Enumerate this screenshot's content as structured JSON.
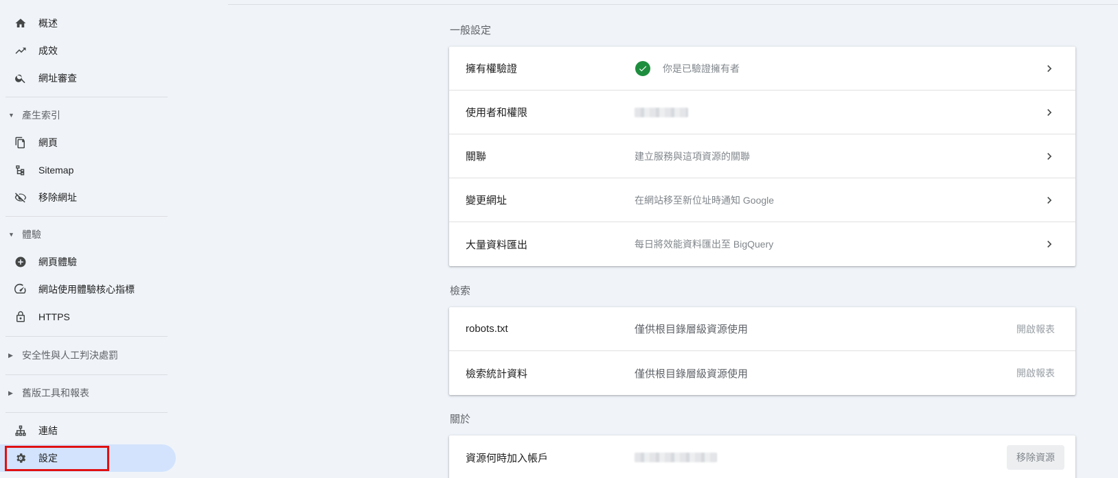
{
  "sidebar": {
    "items": {
      "overview": "概述",
      "performance": "成效",
      "url_inspection": "網址審查",
      "pages": "網頁",
      "sitemaps": "Sitemap",
      "removals": "移除網址",
      "page_experience": "網頁體驗",
      "core_web_vitals": "網站使用體驗核心指標",
      "https": "HTTPS",
      "links": "連結",
      "settings": "設定"
    },
    "sections": {
      "indexing": "產生索引",
      "experience": "體驗",
      "security": "安全性與人工判決處罰",
      "legacy": "舊版工具和報表"
    }
  },
  "main": {
    "general": {
      "title": "一般設定",
      "rows": [
        {
          "label": "擁有權驗證",
          "desc": "你是已驗證擁有者"
        },
        {
          "label": "使用者和權限",
          "desc": ""
        },
        {
          "label": "關聯",
          "desc": "建立服務與這項資源的關聯"
        },
        {
          "label": "變更網址",
          "desc": "在網站移至新位址時通知 Google"
        },
        {
          "label": "大量資料匯出",
          "desc": "每日將效能資料匯出至 BigQuery"
        }
      ]
    },
    "crawling": {
      "title": "檢索",
      "rows": [
        {
          "label": "robots.txt",
          "desc": "僅供根目錄層級資源使用",
          "action": "開啟報表"
        },
        {
          "label": "檢索統計資料",
          "desc": "僅供根目錄層級資源使用",
          "action": "開啟報表"
        }
      ]
    },
    "about": {
      "title": "關於",
      "rows": [
        {
          "label": "資源何時加入帳戶",
          "action": "移除資源"
        }
      ]
    }
  },
  "colors": {
    "background": "#f0f4f9",
    "active_item": "#d3e3fd",
    "verified_check": "#1e8e3e",
    "highlight": "#e01010"
  }
}
